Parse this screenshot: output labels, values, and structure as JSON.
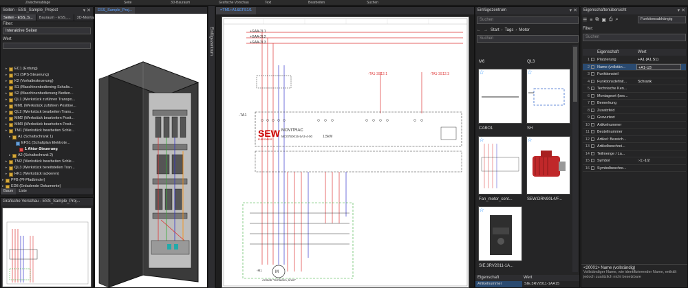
{
  "topbar": {
    "zwischenablage": "Zwischenablage",
    "seite": "Seite",
    "bauraum": "3D-Bauraum",
    "grafische_vorschau": "Grafische Vorschau",
    "text": "Text",
    "bearbeiten": "Bearbeiten",
    "suchen": "Suchen"
  },
  "left": {
    "title": "Seiten - ESS_Sample_Project",
    "tabs": [
      "Seiten - ESS_S...",
      "Bauraum - ESS_...",
      "3D-Montagea..."
    ],
    "filter_label": "Filter:",
    "filter_value": "Interaktive Seiten",
    "wert_label": "Wert",
    "tree": [
      {
        "label": "EC1 (Erdung)",
        "icon": "folder-icon",
        "depth": 1
      },
      {
        "label": "K1 (SPS-Steuerung)",
        "icon": "folder-icon",
        "depth": 1
      },
      {
        "label": "K2 (Vorhaltesteuerung)",
        "icon": "folder-icon",
        "depth": 1
      },
      {
        "label": "S1 (Maschinenbediening Schalts...",
        "icon": "folder-icon",
        "depth": 1
      },
      {
        "label": "S2 (Maschinenbedienung Bedien...",
        "icon": "folder-icon",
        "depth": 1
      },
      {
        "label": "QL1 (Werkstück zuführen Transpo...",
        "icon": "folder-icon",
        "depth": 1
      },
      {
        "label": "MM1 (Werkstück zuführen Positioe...",
        "icon": "folder-icon",
        "depth": 1
      },
      {
        "label": "QL2 (Werkstück bearbeiten Trans...",
        "icon": "folder-icon",
        "depth": 1
      },
      {
        "label": "MM2 (Werkstück bearbeiten Posit...",
        "icon": "folder-icon",
        "depth": 1
      },
      {
        "label": "MM3 (Werkstück bearbeiten Posit...",
        "icon": "folder-icon",
        "depth": 1
      },
      {
        "label": "TM1 (Werkstück bearbeiten Schle...",
        "icon": "folder-icon",
        "depth": 1
      },
      {
        "label": "A1 (Schaltschrank 1)",
        "icon": "folder-icon",
        "depth": 2
      },
      {
        "label": "EFS1 (Schaltplan Elektrote...",
        "icon": "page-icon",
        "depth": 3
      },
      {
        "label": "1 Aktor-Steuerung",
        "icon": "sheet-icon",
        "depth": 4,
        "bold": true
      },
      {
        "label": "A2 (Schaltschrank 2)",
        "icon": "folder-icon",
        "depth": 2
      },
      {
        "label": "TM2 (Werkstück bearbeiten Schle...",
        "icon": "folder-icon",
        "depth": 1
      },
      {
        "label": "QL3 (Werkstück bereitstellen Tran...",
        "icon": "folder-icon",
        "depth": 1
      },
      {
        "label": "HK1 (Werkstück lackieren)",
        "icon": "folder-icon",
        "depth": 1
      },
      {
        "label": "PFB (Pf-Pfadbinder)",
        "icon": "folder-icon",
        "depth": 0
      },
      {
        "label": "ED8 (Erdadende Dokumente)",
        "icon": "folder-icon",
        "depth": 0
      }
    ],
    "bottom_tabs": [
      "Baum",
      "Liste"
    ],
    "preview_title": "Grafische Vorschau - ESS_Sample_Proj..."
  },
  "cabinet_tab": "ESS_Sample_Proj...",
  "schematic": {
    "tab": "=TM1+A1&EFS1/1",
    "einfuegezentrum_vertical": "Einfügezentrum",
    "net_labels": [
      "+GAA-2L1",
      "+GAA-2L2",
      "+GAA-2L3"
    ],
    "device_refs": [
      "-TA1-3S12.1",
      "-TA1-3S12.3"
    ],
    "drive_label": "-TA1",
    "brand": "SEW",
    "brand_sub": "EURODRIVE",
    "product": "MOVITRAC",
    "product_code": "MC07B0015-5A3-4-00",
    "power": "1,5kW",
    "motor_label": "Antrieb \"Schleifen, links\"",
    "motor_ref": "-M1"
  },
  "insertion": {
    "title": "Einfügezentrum",
    "search_placeholder": "Suchen",
    "breadcrumb": [
      "Start",
      "Tags",
      "Motor"
    ],
    "search2_placeholder": "Suchen",
    "items": [
      {
        "caption": "M6",
        "kind": "line"
      },
      {
        "caption": "QL3",
        "kind": "motor-symbol"
      },
      {
        "caption": "CABO1",
        "kind": "schematic"
      },
      {
        "caption": "SH",
        "kind": "motor-photo"
      },
      {
        "caption": "Fan_motor_cont...",
        "kind": "contactor"
      },
      {
        "caption": "SEW.DRN90L4/F...",
        "kind": "blank"
      },
      {
        "caption": "SIE.3RV2011-1A...",
        "kind": "blank"
      }
    ],
    "eigenschaft_title": "Eigenschaft",
    "wert_header": "Wert",
    "bottom_row_value": "Artikelnummer",
    "bottom_row_wert": "SIE.3RV2011-1AA15"
  },
  "properties": {
    "title": "Eigenschaftenübersicht",
    "mode": "Funktionsabhängig",
    "filter_label": "Filter:",
    "search_placeholder": "Suchen",
    "col_eigenschaft": "Eigenschaft",
    "col_wert": "Wert",
    "rows": [
      {
        "n": "1",
        "label": "Platzierung",
        "value": "+A1 (A1.S1)"
      },
      {
        "n": "2",
        "label": "Name (vollstän...",
        "value": "+A1-U3"
      },
      {
        "n": "3",
        "label": "Funktionsteil",
        "value": ""
      },
      {
        "n": "4",
        "label": "Funktionsdefinit...",
        "value": "Schrank"
      },
      {
        "n": "5",
        "label": "Technische Ken...",
        "value": ""
      },
      {
        "n": "6",
        "label": "Montageort (bes...",
        "value": ""
      },
      {
        "n": "7",
        "label": "Bemerkung",
        "value": ""
      },
      {
        "n": "8",
        "label": "Zusatzfeld",
        "value": ""
      },
      {
        "n": "9",
        "label": "Gravurtext",
        "value": ""
      },
      {
        "n": "10",
        "label": "Artikelnummer",
        "value": ""
      },
      {
        "n": "11",
        "label": "Bestellnummer",
        "value": ""
      },
      {
        "n": "12",
        "label": "Artikel: Bezeich...",
        "value": ""
      },
      {
        "n": "13",
        "label": "Artikelbeschrei...",
        "value": ""
      },
      {
        "n": "14",
        "label": "Teilmenge / La...",
        "value": ""
      },
      {
        "n": "15",
        "label": "Symbol",
        "value": ":-1;-1/2"
      },
      {
        "n": "16",
        "label": "Symbolbeschre...",
        "value": ""
      }
    ],
    "desc_title": "<20001> Name (vollständig)",
    "desc_text": "Vollständiger Name, wie identifizierender Name, enthält jedoch zusätzlich nicht besetzbare"
  }
}
